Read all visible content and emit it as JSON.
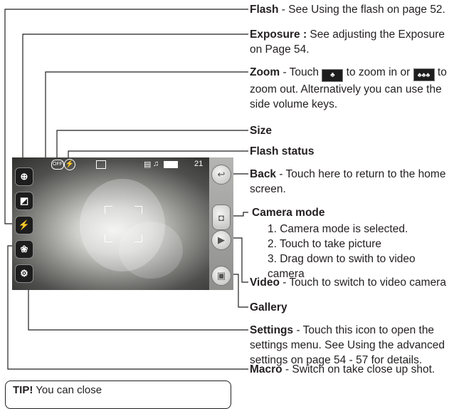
{
  "callouts": {
    "flash": {
      "title": "Flash",
      "text": " - See Using the flash on page 52."
    },
    "exposure": {
      "title": "Exposure :",
      "text": " See adjusting the Exposure on Page 54."
    },
    "zoom": {
      "title": "Zoom",
      "text_1": " - Touch ",
      "text_2": " to zoom in or ",
      "text_3": " to zoom out. Alternatively you can use the side volume keys."
    },
    "size": {
      "title": "Size"
    },
    "flash_status": {
      "title": "Flash status"
    },
    "back": {
      "title": "Back",
      "text": " - Touch here to return to the home screen."
    },
    "camera_mode": {
      "title": "Camera mode",
      "steps": [
        "1. Camera mode is selected.",
        "2. Touch to take picture",
        "3. Drag down to swith to video camera"
      ]
    },
    "video": {
      "title": "Video",
      "text": " - Touch to switch to video camera"
    },
    "gallery": {
      "title": "Gallery"
    },
    "settings": {
      "title": "Settings",
      "text": " - Touch this icon to open the settings menu. See Using the advanced settings on page 54 - 57 for details."
    },
    "macro": {
      "title": "Macro",
      "text": " - Switch on take close up shot."
    }
  },
  "screen": {
    "shot_count": "21",
    "flash_status_icon": "flash-auto-icon",
    "size_icon": "size-icon",
    "left_buttons": [
      "zoom-icon",
      "exposure-icon",
      "flash-icon",
      "macro-icon",
      "settings-icon"
    ],
    "right_buttons": [
      "back-icon",
      "camera-icon",
      "video-icon",
      "gallery-icon"
    ]
  },
  "tip": {
    "label": "TIP!",
    "text": " You can close"
  }
}
